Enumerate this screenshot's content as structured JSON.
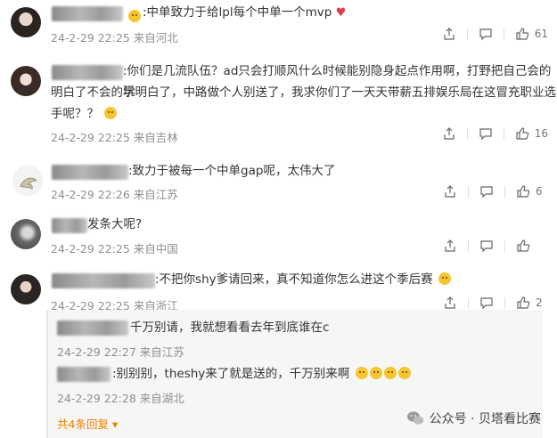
{
  "comments": [
    {
      "text": ":中单致力于给lpl每个中单一个mvp",
      "date": "24-2-29 22:25",
      "location": "来自河北",
      "likes": "61"
    },
    {
      "text_line1": ":你们是几流队伍？ad只会打顺风什么时候能别隐身起点作用啊，打野把自己会的玩",
      "text_line2": "明白了不会的学明白了，中路做个人别送了，我求你们了一天天带薪五排娱乐局在这冒充职业选",
      "text_line3": "手呢？？",
      "date": "24-2-29 22:25",
      "location": "来自吉林",
      "likes": "16"
    },
    {
      "text": ":致力于被每一个中单gap呢，太伟大了",
      "date": "24-2-29 22:26",
      "location": "来自江苏",
      "likes": "6"
    },
    {
      "text": "发条大呢?",
      "date": "24-2-29 22:25",
      "location": "来自中国",
      "likes": ""
    },
    {
      "text": ":不把你shy爹请回来，真不知道你怎么进这个季后赛",
      "date": "24-2-29 22:25",
      "location": "来自浙江",
      "likes": "2"
    }
  ],
  "replies": [
    {
      "text": "千万别请，我就想看看去年到底谁在c",
      "date": "24-2-29 22:27",
      "location": "来自江苏"
    },
    {
      "text": ":别别别，theshy来了就是送的，千万别来啊",
      "date": "24-2-29 22:28",
      "location": "来自湖北"
    }
  ],
  "more_replies": "共4条回复",
  "watermark": "公众号 · 贝塔看比赛",
  "colors": {
    "accent": "#f07e00",
    "heart": "#e0394e",
    "meta": "#8f8f8f"
  },
  "icons": [
    "share-icon",
    "comment-icon",
    "like-icon",
    "heart-icon",
    "wechat-icon"
  ]
}
